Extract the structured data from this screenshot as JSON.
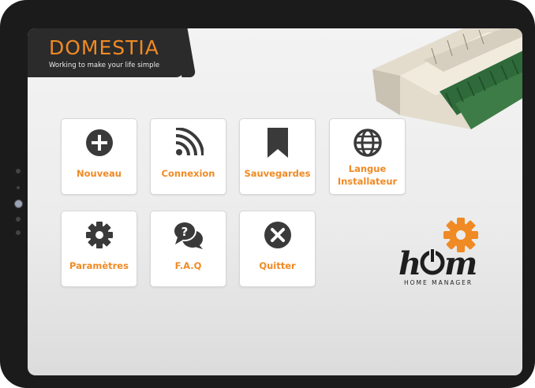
{
  "brand": {
    "title": "DOMESTIA",
    "tagline": "Working to make your life simple",
    "accent_color": "#f08a24"
  },
  "menu": {
    "tiles": [
      {
        "label": "Nouveau",
        "icon": "plus-circle-icon"
      },
      {
        "label": "Connexion",
        "icon": "wifi-signal-icon"
      },
      {
        "label": "Sauvegardes",
        "icon": "bookmark-icon"
      },
      {
        "label_line1": "Langue",
        "label_line2": "Installateur",
        "icon": "globe-icon"
      },
      {
        "label": "Paramètres",
        "icon": "gear-icon"
      },
      {
        "label": "F.A.Q",
        "icon": "faq-chat-icon"
      },
      {
        "label": "Quitter",
        "icon": "close-circle-icon"
      }
    ]
  },
  "home_manager": {
    "logo_text": "hOm",
    "subtitle": "HOME MANAGER"
  }
}
